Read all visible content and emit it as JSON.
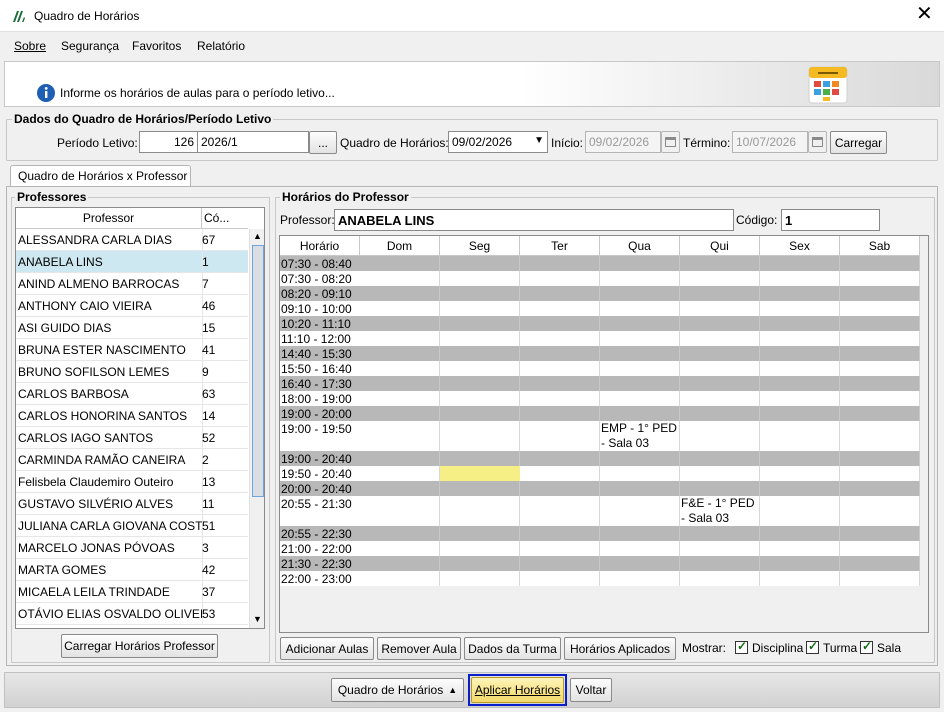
{
  "window": {
    "title": "Quadro de Horários"
  },
  "menu": [
    "Sobre",
    "Segurança",
    "Favoritos",
    "Relatório"
  ],
  "info": {
    "message": "Informe os horários de aulas para o período letivo..."
  },
  "periodo": {
    "group_title": "Dados do Quadro de Horários/Período Letivo",
    "periodo_label": "Período Letivo:",
    "periodo_code": "126",
    "periodo_value": "2026/1",
    "browse_label": "...",
    "quadro_label": "Quadro de Horários:",
    "quadro_value": "09/02/2026",
    "inicio_label": "Início:",
    "inicio_value": "09/02/2026",
    "termino_label": "Término:",
    "termino_value": "10/07/2026",
    "carregar_label": "Carregar"
  },
  "tab": {
    "label": "Quadro de Horários x Professor"
  },
  "professores": {
    "group_title": "Professores",
    "col_name": "Professor",
    "col_code": "Có...",
    "rows": [
      {
        "name": "ALESSANDRA CARLA DIAS",
        "code": "67"
      },
      {
        "name": "ANABELA LINS",
        "code": "1"
      },
      {
        "name": "ANIND ALMENO BARROCAS",
        "code": "7"
      },
      {
        "name": "ANTHONY CAIO VIEIRA",
        "code": "46"
      },
      {
        "name": "ASI GUIDO DIAS",
        "code": "15"
      },
      {
        "name": "BRUNA ESTER NASCIMENTO",
        "code": "41"
      },
      {
        "name": "BRUNO SOFILSON LEMES",
        "code": "9"
      },
      {
        "name": "CARLOS BARBOSA",
        "code": "63"
      },
      {
        "name": "CARLOS HONORINA SANTOS",
        "code": "14"
      },
      {
        "name": "CARLOS IAGO SANTOS",
        "code": "52"
      },
      {
        "name": "CARMINDA RAMÃO CANEIRA",
        "code": "2"
      },
      {
        "name": "Felisbela Claudemiro Outeiro",
        "code": "13"
      },
      {
        "name": "GUSTAVO SILVÉRIO ALVES",
        "code": "11"
      },
      {
        "name": "JULIANA CARLA GIOVANA COSTA",
        "code": "51"
      },
      {
        "name": "MARCELO JONAS PÓVOAS",
        "code": "3"
      },
      {
        "name": "MARTA GOMES",
        "code": "42"
      },
      {
        "name": "MICAELA LEILA TRINDADE",
        "code": "37"
      },
      {
        "name": "OTÁVIO ELIAS OSVALDO OLIVEIRA",
        "code": "53"
      }
    ],
    "load_button": "Carregar Horários Professor"
  },
  "horarios": {
    "group_title": "Horários do Professor",
    "professor_label": "Professor:",
    "professor_value": "ANABELA LINS",
    "codigo_label": "Código:",
    "codigo_value": "1",
    "columns": [
      "Horário",
      "Dom",
      "Seg",
      "Ter",
      "Qua",
      "Qui",
      "Sex",
      "Sab"
    ],
    "slots": [
      {
        "time": "07:30 - 08:40",
        "gray": true
      },
      {
        "time": "07:30 - 08:20",
        "gray": false
      },
      {
        "time": "08:20 - 09:10",
        "gray": true
      },
      {
        "time": "09:10 - 10:00",
        "gray": false
      },
      {
        "time": "10:20 - 11:10",
        "gray": true
      },
      {
        "time": "11:10 - 12:00",
        "gray": false
      },
      {
        "time": "14:40 - 15:30",
        "gray": true
      },
      {
        "time": "15:50 - 16:40",
        "gray": false
      },
      {
        "time": "16:40 - 17:30",
        "gray": true
      },
      {
        "time": "18:00 - 19:00",
        "gray": false
      },
      {
        "time": "19:00 - 20:00",
        "gray": true
      },
      {
        "time": "19:00 - 19:50",
        "gray": false,
        "tall": true
      },
      {
        "time": "19:00 - 20:40",
        "gray": true
      },
      {
        "time": "19:50 - 20:40",
        "gray": false
      },
      {
        "time": "20:00 - 20:40",
        "gray": true
      },
      {
        "time": "20:55 - 21:30",
        "gray": false,
        "tall": true
      },
      {
        "time": "20:55 - 22:30",
        "gray": true
      },
      {
        "time": "21:00 - 22:00",
        "gray": false
      },
      {
        "time": "21:30 - 22:30",
        "gray": true
      },
      {
        "time": "22:00 - 23:00",
        "gray": false
      }
    ],
    "entries": [
      {
        "slot": 11,
        "day": "Qua",
        "text": "EMP - 1° PED - Sala 03"
      },
      {
        "slot": 15,
        "day": "Qui",
        "text": "F&E - 1° PED - Sala 03"
      }
    ],
    "highlight": {
      "slot": 13,
      "day": "Seg",
      "color": "#f5ef86"
    },
    "buttons": {
      "adicionar": "Adicionar Aulas",
      "remover": "Remover Aula",
      "dados": "Dados da Turma",
      "aplicados": "Horários Aplicados"
    },
    "mostrar_label": "Mostrar:",
    "checks": [
      {
        "label": "Disciplina",
        "checked": true
      },
      {
        "label": "Turma",
        "checked": true
      },
      {
        "label": "Sala",
        "checked": true
      }
    ]
  },
  "footer": {
    "quadro_button": "Quadro de Horários",
    "aplicar_button": "Aplicar Horários",
    "voltar_button": "Voltar"
  },
  "colors": {
    "selected_row": "#cde8f0",
    "gray_row": "#b8b8b8",
    "focus_border": "#0a1fc8"
  }
}
